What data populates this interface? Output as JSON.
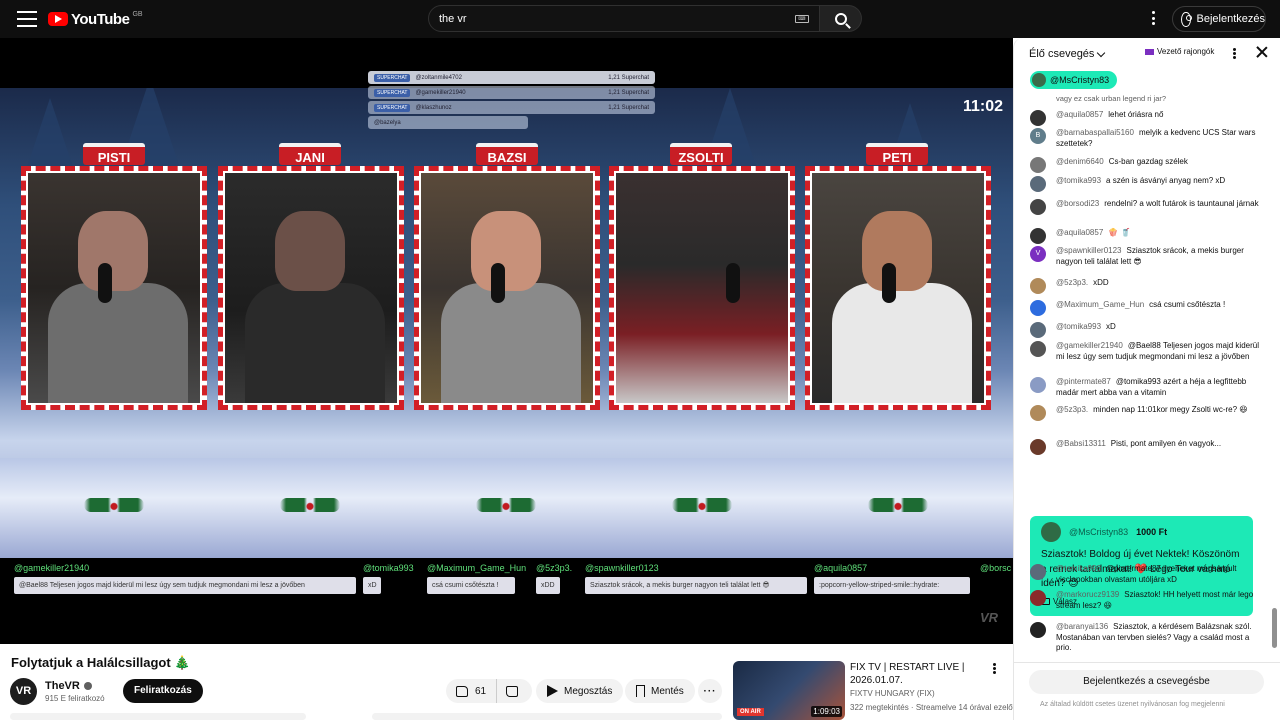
{
  "header": {
    "logo_text": "YouTube",
    "country": "GB",
    "search_value": "the vr",
    "signin_label": "Bejelentkezés"
  },
  "video": {
    "timer": "11:02",
    "names": [
      "PISTI",
      "JANI",
      "BAZSI",
      "ZSOLTI",
      "PETI"
    ],
    "superchats": [
      {
        "tag": "SUPERCHAT",
        "user": "@zoltanmile4702",
        "amount": "1,21 Superchat"
      },
      {
        "tag": "SUPERCHAT",
        "user": "@gamekiller21940",
        "amount": "1,21 Superchat"
      },
      {
        "tag": "SUPERCHAT",
        "user": "@klaszhunoz",
        "amount": "1,21 Superchat"
      },
      {
        "tag": "",
        "user": "@bazelya",
        "amount": ""
      }
    ],
    "ticker": [
      {
        "user": "@gamekiller21940",
        "msg": "@Bael88 Teljesen jogos majd kiderül mi lesz úgy sem tudjuk megmondani mi lesz a jövőben"
      },
      {
        "user": "@tomika993",
        "msg": "xD"
      },
      {
        "user": "@Maximum_Game_Hun",
        "msg": "csá csumi csőtészta !"
      },
      {
        "user": "@5z3p3.",
        "msg": "xDD"
      },
      {
        "user": "@spawnkiller0123",
        "msg": "Sziasztok srácok, a mekis burger nagyon teli találat lett 😎"
      },
      {
        "user": "@aquila0857",
        "msg": ":popcorn-yellow-striped-smile::hydrate:"
      },
      {
        "user": "@borsc",
        "msg": ""
      }
    ],
    "watermark": "VR"
  },
  "details": {
    "title": "Folytatjuk a Halálcsillagot 🎄",
    "channel": "TheVR",
    "channel_avatar": "VR",
    "subscribers": "915 E feliratkozó",
    "subscribe_label": "Feliratkozás",
    "likes": "61",
    "share_label": "Megosztás",
    "save_label": "Mentés"
  },
  "recommendation": {
    "title": "FIX TV | RESTART LIVE | 2026.01.07.",
    "channel": "FIXTV HUNGARY (FIX)",
    "meta": "322 megtekintés · Streamelve 14 órával ezelőtt",
    "duration": "1:09:03",
    "badge": "ON AIR"
  },
  "chat": {
    "title": "Élő csevegés",
    "fans_label": "Vezető rajongók",
    "pinned_user": "@MsCristyn83",
    "cut_line": "vagy ez csak urban legend ri jar?",
    "messages": [
      {
        "author": "@aquila0857",
        "text": "lehet óriásra nő",
        "avatar_color": "#333333",
        "initial": ""
      },
      {
        "author": "@barnabaspallai5160",
        "text": "melyik a kedvenc UCS Star wars szettetek?",
        "avatar_color": "#607d8b",
        "initial": "B"
      },
      {
        "author": "@denim6640",
        "text": "Cs-ban gazdag szélek",
        "avatar_color": "#777777",
        "initial": ""
      },
      {
        "author": "@tomika993",
        "text": "a szén is ásványi anyag nem? xD",
        "avatar_color": "#5a6a7a",
        "initial": ""
      },
      {
        "author": "@borsodi23",
        "text": "rendelni? a wolt futárok is tauntaunal járnak",
        "avatar_color": "#444444",
        "initial": ""
      },
      {
        "author": "@aquila0857",
        "text": "🍿 🥤",
        "avatar_color": "#333333",
        "initial": ""
      },
      {
        "author": "@spawnkiller0123",
        "text": "Sziasztok srácok, a mekis burger nagyon teli találat lett 😎",
        "avatar_color": "#7b2fc0",
        "initial": "V"
      },
      {
        "author": "@5z3p3.",
        "text": "xDD",
        "avatar_color": "#b08a5a",
        "initial": ""
      },
      {
        "author": "@Maximum_Game_Hun",
        "text": "csá csumi csőtészta !",
        "avatar_color": "#2d6cdf",
        "initial": ""
      },
      {
        "author": "@tomika993",
        "text": "xD",
        "avatar_color": "#5a6a7a",
        "initial": ""
      },
      {
        "author": "@gamekiller21940",
        "text": "@Bael88 Teljesen jogos majd kiderül mi lesz úgy sem tudjuk megmondani mi lesz a jövőben",
        "avatar_color": "#555555",
        "initial": ""
      },
      {
        "author": "@pintermate87",
        "text": "@tomika993 azért a héja a legfittebb madár mert abba van a vitamin",
        "avatar_color": "#8a9bc4",
        "initial": ""
      },
      {
        "author": "@5z3p3.",
        "text": "minden nap 11:01kor megy Zsolti wc-re? 😆",
        "avatar_color": "#b08a5a",
        "initial": ""
      },
      {
        "author": "@Babsi13311",
        "text": "Pisti, pont amilyen én vagyok...",
        "avatar_color": "#6a3a2a",
        "initial": ""
      }
    ],
    "superchat": {
      "author": "@MsCristyn83",
      "amount": "1000 Ft",
      "text": "Sziasztok! Boldog új évet Nektek! Köszönöm a remek tartalmakat! ❤️ Lego Tour várható idén? 😊",
      "reply_label": "Válasz"
    },
    "after": [
      {
        "author": "@tomika993",
        "text": "@pintermate87 ilyeneket megsárgult vicclapokban olvastam utóljára xD",
        "avatar_color": "#5a6a7a",
        "initial": ""
      },
      {
        "author": "@markorucz9139",
        "text": "Sziasztok! HH helyett most már lego stream lesz? 😆",
        "avatar_color": "#8a2a2a",
        "initial": ""
      },
      {
        "author": "@baranyai136",
        "text": "Sziasztok, a kérdésem Balázsnak szól. Mostanában van tervben sielés? Vagy a család most a prio.",
        "avatar_color": "#222222",
        "initial": ""
      }
    ],
    "login_label": "Bejelentkezés a csevegésbe",
    "note": "Az általad küldött csetes üzenet nyilvánosan fog megjelenni"
  }
}
